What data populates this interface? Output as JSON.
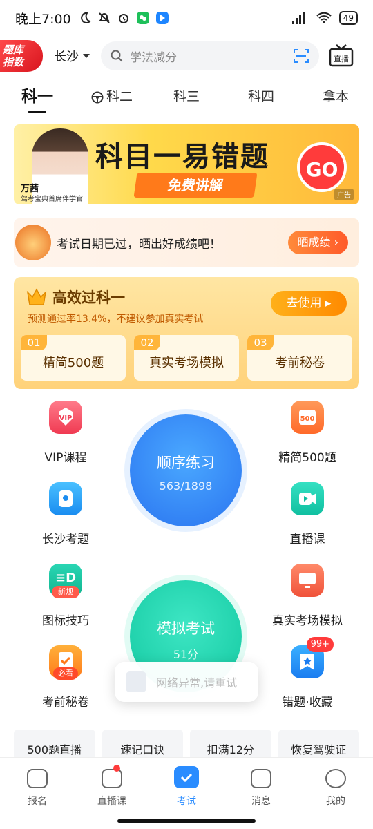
{
  "statusbar": {
    "time": "晚上7:00",
    "battery": "49"
  },
  "header": {
    "logo_line1": "题库",
    "logo_line2": "指数",
    "city": "长沙",
    "search_placeholder": "学法减分",
    "live_label": "直播"
  },
  "tabs": [
    {
      "label": "科一",
      "active": true
    },
    {
      "label": "科二"
    },
    {
      "label": "科三"
    },
    {
      "label": "科四"
    },
    {
      "label": "拿本"
    }
  ],
  "banner": {
    "title": "科目一易错题",
    "subtitle": "免费讲解",
    "teacher_name": "万茜",
    "teacher_role": "驾考宝典首席伴学官",
    "go": "GO",
    "ad_tag": "广告"
  },
  "notice": {
    "text": "考试日期已过，晒出好成绩吧！",
    "button": "晒成绩 ›"
  },
  "efficient": {
    "title": "高效过科一",
    "subtitle": "预测通过率13.4%，不建议参加真实考试",
    "button": "去使用 ▸",
    "items": [
      {
        "num": "01",
        "label": "精简500题"
      },
      {
        "num": "02",
        "label": "真实考场模拟"
      },
      {
        "num": "03",
        "label": "考前秘卷"
      }
    ]
  },
  "grid": {
    "vip": "VIP课程",
    "jj500": "精简500题",
    "changsha": "长沙考题",
    "live": "直播课",
    "icon_tips": "图标技巧",
    "real_exam": "真实考场模拟",
    "secret": "考前秘卷",
    "wrong": "错题·收藏",
    "wrong_badge": "99+",
    "icon_new": "新规",
    "secret_tag": "必看"
  },
  "practice": {
    "title": "顺序练习",
    "progress": "563/1898"
  },
  "mock": {
    "title": "模拟考试",
    "score": "51分"
  },
  "toast": {
    "text": "网络异常,请重试"
  },
  "quick": [
    "500题直播",
    "速记口诀",
    "扣满12分",
    "恢复驾驶证"
  ],
  "bottomnav": [
    {
      "label": "报名"
    },
    {
      "label": "直播课"
    },
    {
      "label": "考试",
      "active": true
    },
    {
      "label": "消息"
    },
    {
      "label": "我的"
    }
  ]
}
